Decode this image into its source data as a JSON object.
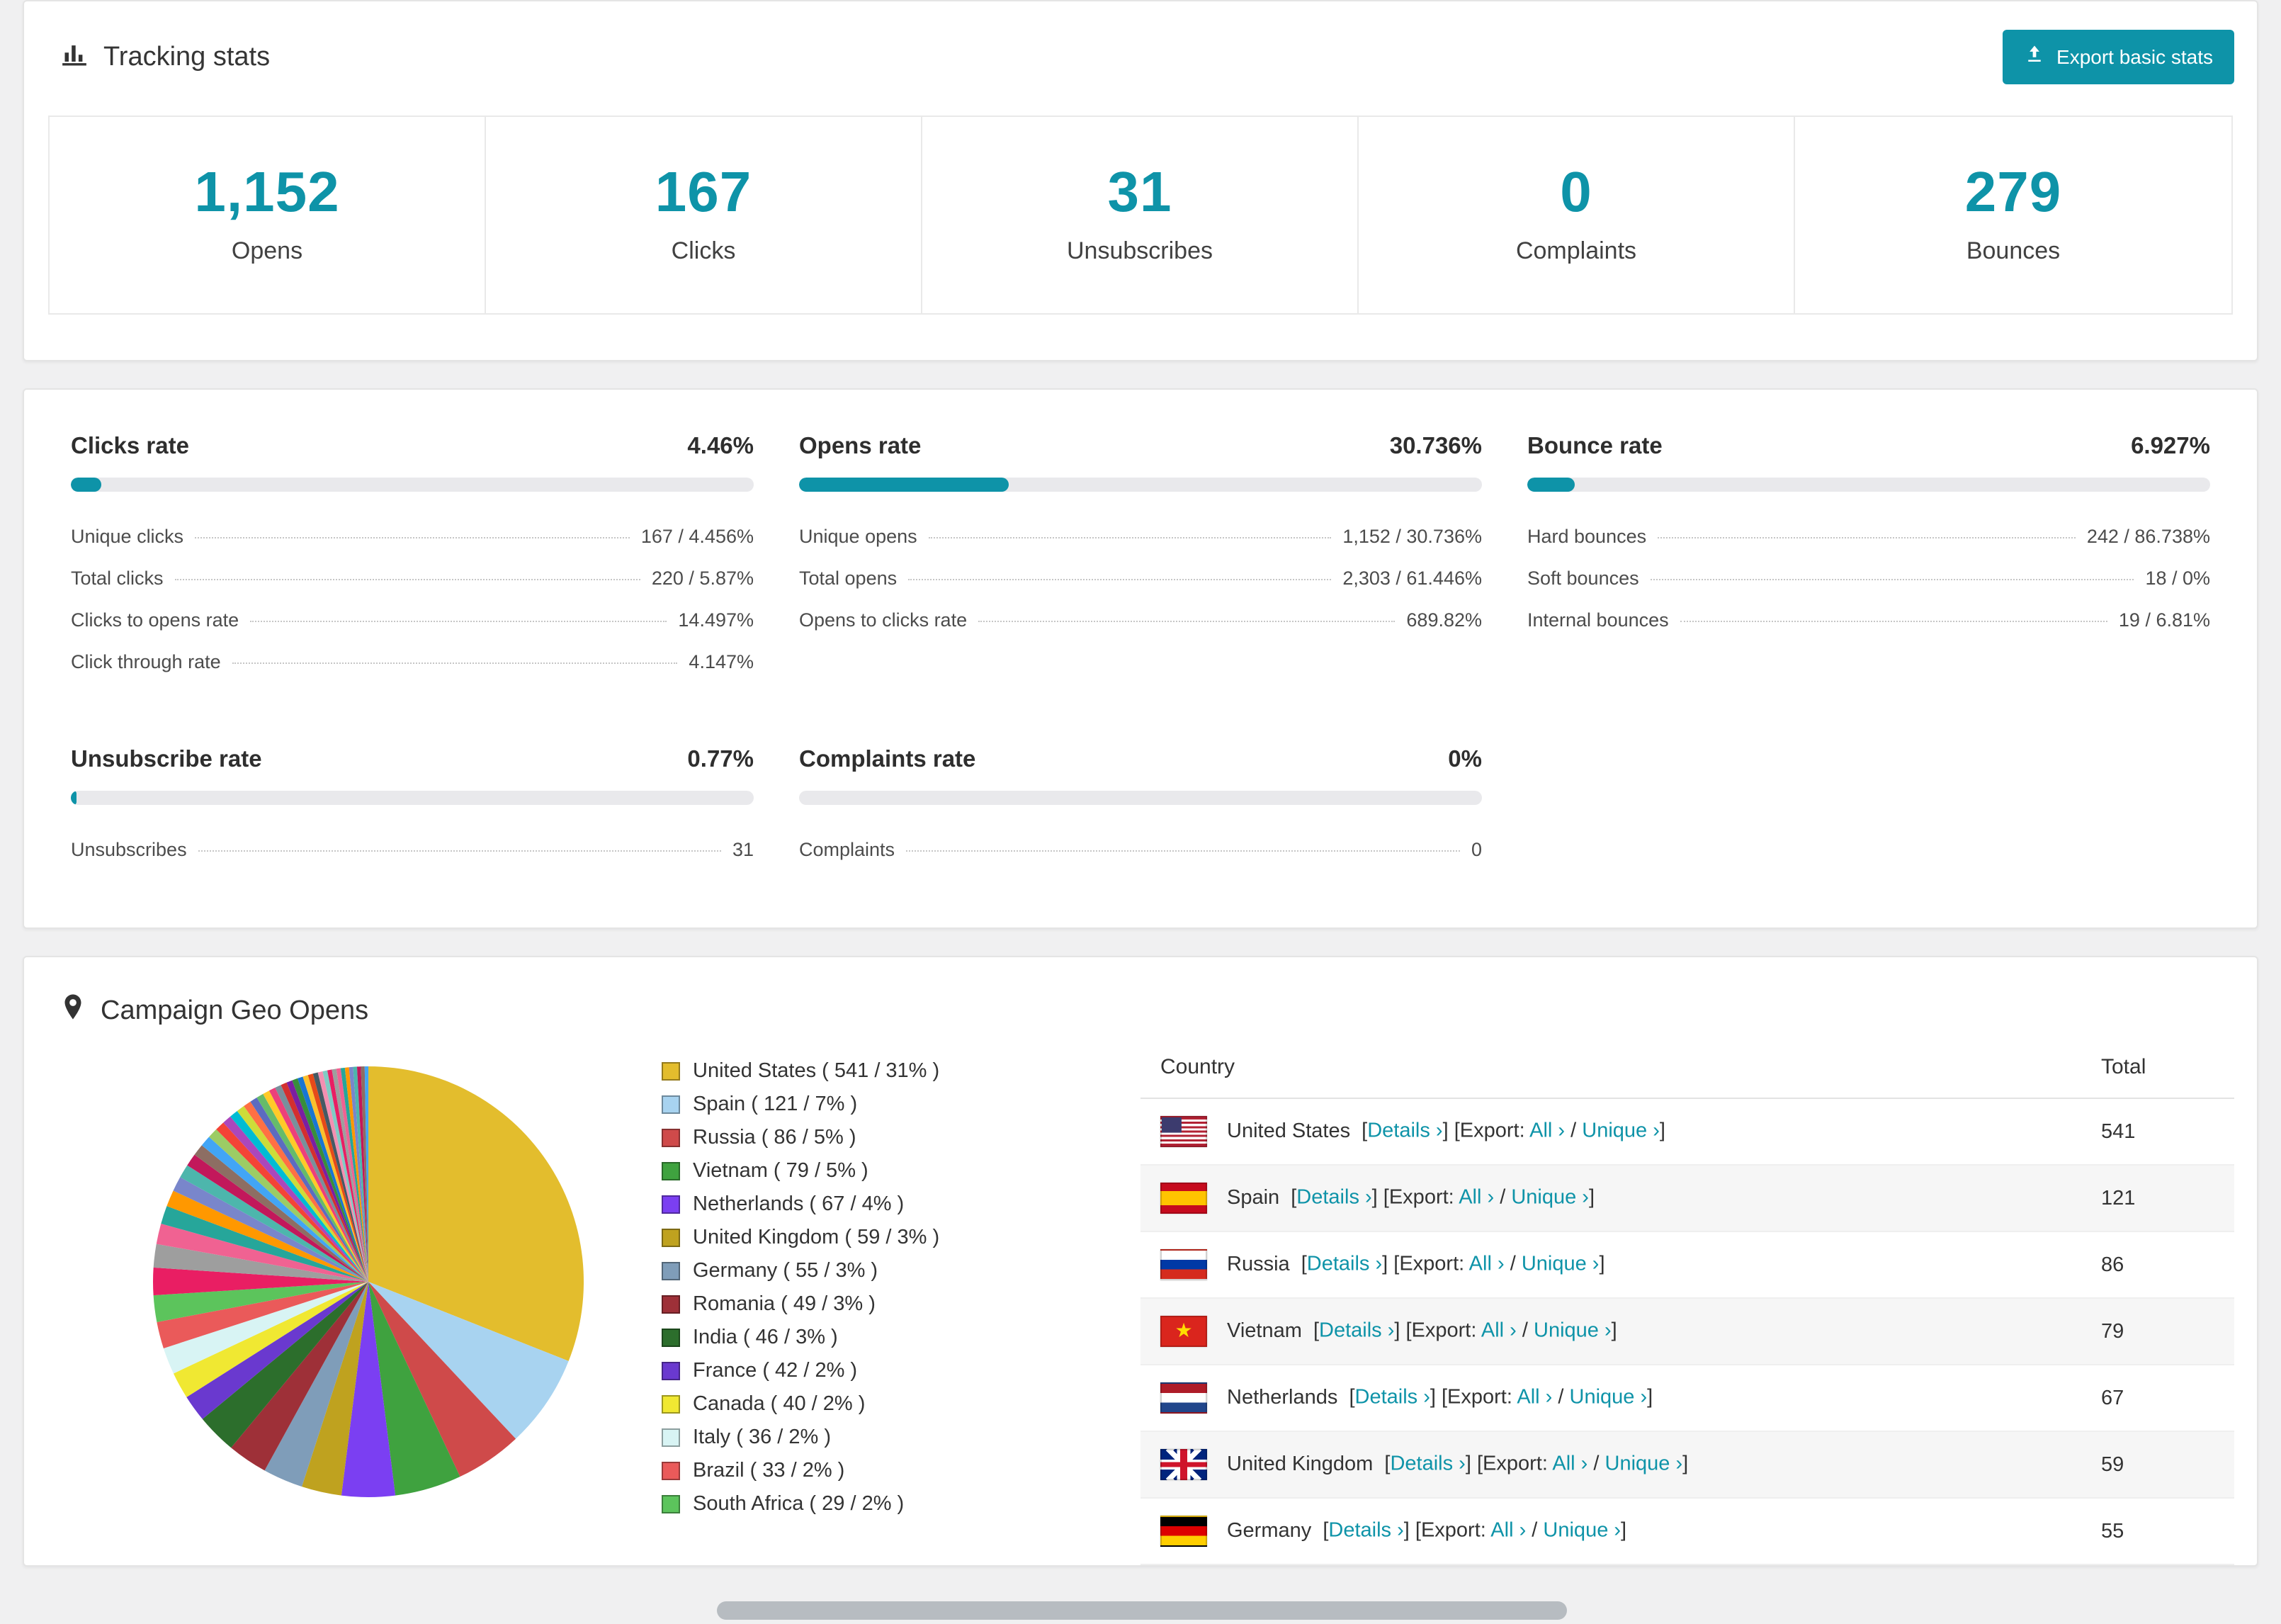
{
  "theme": {
    "accent": "#0e93a8",
    "bar_track": "#e9e9ec",
    "page_background": "#f0f0f1"
  },
  "icons": {
    "tracking": "bar-chart-icon",
    "export": "export-upload-icon",
    "geo": "map-pin-icon"
  },
  "tracking": {
    "title": "Tracking stats",
    "export_button": "Export basic stats",
    "stats": [
      {
        "value": "1,152",
        "label": "Opens"
      },
      {
        "value": "167",
        "label": "Clicks"
      },
      {
        "value": "31",
        "label": "Unsubscribes"
      },
      {
        "value": "0",
        "label": "Complaints"
      },
      {
        "value": "279",
        "label": "Bounces"
      }
    ]
  },
  "rates": [
    {
      "title": "Clicks rate",
      "value": "4.46%",
      "percent": 4.46,
      "rows": [
        {
          "label": "Unique clicks",
          "value": "167 / 4.456%"
        },
        {
          "label": "Total clicks",
          "value": "220 / 5.87%"
        },
        {
          "label": "Clicks to opens rate",
          "value": "14.497%"
        },
        {
          "label": "Click through rate",
          "value": "4.147%"
        }
      ]
    },
    {
      "title": "Opens rate",
      "value": "30.736%",
      "percent": 30.736,
      "rows": [
        {
          "label": "Unique opens",
          "value": "1,152 / 30.736%"
        },
        {
          "label": "Total opens",
          "value": "2,303 / 61.446%"
        },
        {
          "label": "Opens to clicks rate",
          "value": "689.82%"
        }
      ]
    },
    {
      "title": "Bounce rate",
      "value": "6.927%",
      "percent": 6.927,
      "rows": [
        {
          "label": "Hard bounces",
          "value": "242 / 86.738%"
        },
        {
          "label": "Soft bounces",
          "value": "18 / 0%"
        },
        {
          "label": "Internal bounces",
          "value": "19 / 6.81%"
        }
      ]
    },
    {
      "title": "Unsubscribe rate",
      "value": "0.77%",
      "percent": 0.77,
      "rows": [
        {
          "label": "Unsubscribes",
          "value": "31"
        }
      ]
    },
    {
      "title": "Complaints rate",
      "value": "0%",
      "percent": 0,
      "rows": [
        {
          "label": "Complaints",
          "value": "0"
        }
      ]
    }
  ],
  "geo": {
    "title": "Campaign Geo Opens",
    "table": {
      "columns": [
        "Country",
        "Total"
      ],
      "details_label": "Details",
      "export_label": "Export:",
      "all_label": "All",
      "unique_label": "Unique",
      "link_chevron": "›",
      "rows": [
        {
          "country": "United States",
          "total": "541",
          "flag": "us"
        },
        {
          "country": "Spain",
          "total": "121",
          "flag": "es"
        },
        {
          "country": "Russia",
          "total": "86",
          "flag": "ru"
        },
        {
          "country": "Vietnam",
          "total": "79",
          "flag": "vn"
        },
        {
          "country": "Netherlands",
          "total": "67",
          "flag": "nl"
        },
        {
          "country": "United Kingdom",
          "total": "59",
          "flag": "gb"
        },
        {
          "country": "Germany",
          "total": "55",
          "flag": "de"
        }
      ]
    }
  },
  "chart_data": {
    "type": "pie",
    "title": "Campaign Geo Opens",
    "legend_position": "right",
    "legend_format": "label ( count / percent% )",
    "slices": [
      {
        "label": "United States",
        "count": 541,
        "percent": 31,
        "color": "#e3bd2d"
      },
      {
        "label": "Spain",
        "count": 121,
        "percent": 7,
        "color": "#a8d3f0"
      },
      {
        "label": "Russia",
        "count": 86,
        "percent": 5,
        "color": "#cf4a4a"
      },
      {
        "label": "Vietnam",
        "count": 79,
        "percent": 5,
        "color": "#3fa23f"
      },
      {
        "label": "Netherlands",
        "count": 67,
        "percent": 4,
        "color": "#7b3ff2"
      },
      {
        "label": "United Kingdom",
        "count": 59,
        "percent": 3,
        "color": "#bfa21f"
      },
      {
        "label": "Germany",
        "count": 55,
        "percent": 3,
        "color": "#7f9db9"
      },
      {
        "label": "Romania",
        "count": 49,
        "percent": 3,
        "color": "#9e3038"
      },
      {
        "label": "India",
        "count": 46,
        "percent": 3,
        "color": "#2c6e2c"
      },
      {
        "label": "France",
        "count": 42,
        "percent": 2,
        "color": "#6a39cf"
      },
      {
        "label": "Canada",
        "count": 40,
        "percent": 2,
        "color": "#f0e832"
      },
      {
        "label": "Italy",
        "count": 36,
        "percent": 2,
        "color": "#d8f4f4"
      },
      {
        "label": "Brazil",
        "count": 33,
        "percent": 2,
        "color": "#ea5a5a"
      },
      {
        "label": "South Africa",
        "count": 29,
        "percent": 2,
        "color": "#5cc45c"
      }
    ],
    "others": {
      "percent": 26,
      "approx_slice_count": 40,
      "palette": [
        "#e91e63",
        "#9e9e9e",
        "#f06292",
        "#26a69a",
        "#ff9800",
        "#7986cb",
        "#4db6ac",
        "#c2185b",
        "#8d6e63",
        "#42a5f5",
        "#9ccc65",
        "#f44336",
        "#ab47bc",
        "#00bcd4",
        "#cddc39",
        "#ff7043",
        "#5c6bc0",
        "#66bb6a",
        "#ffca28",
        "#ec407a",
        "#78909c",
        "#d32f2f",
        "#7b1fa2",
        "#388e3c",
        "#1976d2",
        "#fbc02d",
        "#e64a19",
        "#455a64",
        "#f48fb1",
        "#80cbc4"
      ]
    }
  }
}
